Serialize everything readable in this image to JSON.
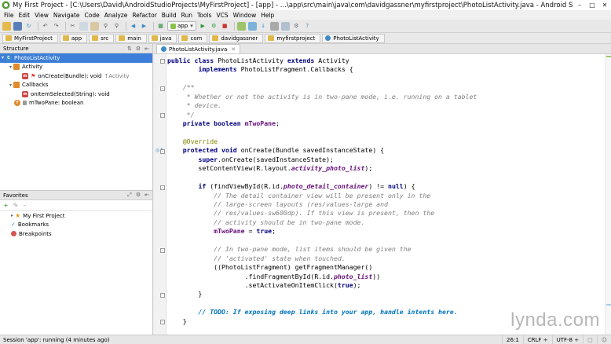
{
  "window": {
    "title": "My First Project - [C:\\Users\\David\\AndroidStudioProjects\\MyFirstProject] - [app] - ...\\app\\src\\main\\java\\com\\davidgassner\\myfirstproject\\PhotoListActivity.java - Android Studio (Beta) 0...."
  },
  "menu": [
    "File",
    "Edit",
    "View",
    "Navigate",
    "Code",
    "Analyze",
    "Refactor",
    "Build",
    "Run",
    "Tools",
    "VCS",
    "Window",
    "Help"
  ],
  "toolbar": {
    "run_config": "app"
  },
  "breadcrumbs": [
    "MyFirstProject",
    "app",
    "src",
    "main",
    "java",
    "com",
    "davidgassner",
    "myfirstproject",
    "PhotoListActivity"
  ],
  "structure": {
    "title": "Structure",
    "items": [
      {
        "label": "PhotoListActivity",
        "suffix": ""
      },
      {
        "label": "Activity",
        "suffix": ""
      },
      {
        "label": "onCreate(Bundle): void",
        "suffix": "↑Activity"
      },
      {
        "label": "Callbacks",
        "suffix": ""
      },
      {
        "label": "onItemSelected(String): void",
        "suffix": ""
      },
      {
        "label": "mTwoPane: boolean",
        "suffix": ""
      }
    ]
  },
  "favorites": {
    "title": "Favorites",
    "items": [
      "My First Project",
      "Bookmarks",
      "Breakpoints"
    ]
  },
  "editor": {
    "tab": "PhotoListActivity.java"
  },
  "status": {
    "message": "Session 'app': running (4 minutes ago)",
    "position": "26:1",
    "line_sep": "CRLF ÷",
    "encoding": "UTF-8 ÷"
  },
  "watermark": "lynda.com"
}
